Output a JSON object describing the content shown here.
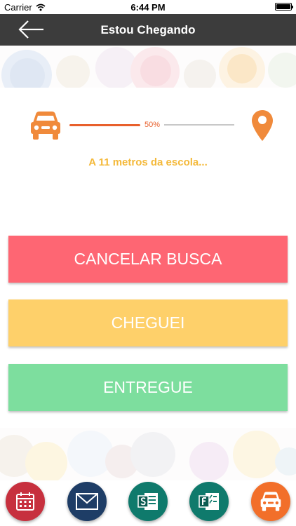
{
  "status_bar": {
    "carrier": "Carrier",
    "time": "6:44 PM"
  },
  "nav": {
    "title": "Estou Chegando",
    "back_icon": "arrow-left-icon"
  },
  "tracking": {
    "start_icon": "car-icon",
    "end_icon": "location-pin-icon",
    "progress_label": "50%",
    "progress_fraction": 0.5,
    "distance_text": "A 11 metros da escola..."
  },
  "actions": {
    "cancel_label": "CANCELAR BUSCA",
    "arrived_label": "CHEGUEI",
    "delivered_label": "ENTREGUE"
  },
  "dock": {
    "items": [
      {
        "icon": "calendar-icon",
        "color": "#c7303e"
      },
      {
        "icon": "mail-icon",
        "color": "#1e3d66"
      },
      {
        "icon": "sharepoint-icon",
        "color": "#0f7a6c"
      },
      {
        "icon": "forms-icon",
        "color": "#0f7a6c"
      },
      {
        "icon": "car-icon",
        "color": "#f26f2a"
      }
    ]
  },
  "colors": {
    "nav_bg": "#3c3c3c",
    "accent": "#e8602c",
    "distance_text": "#f4b93a",
    "cancel": "#fe6673",
    "arrived": "#fed06a",
    "delivered": "#7dde9e"
  }
}
